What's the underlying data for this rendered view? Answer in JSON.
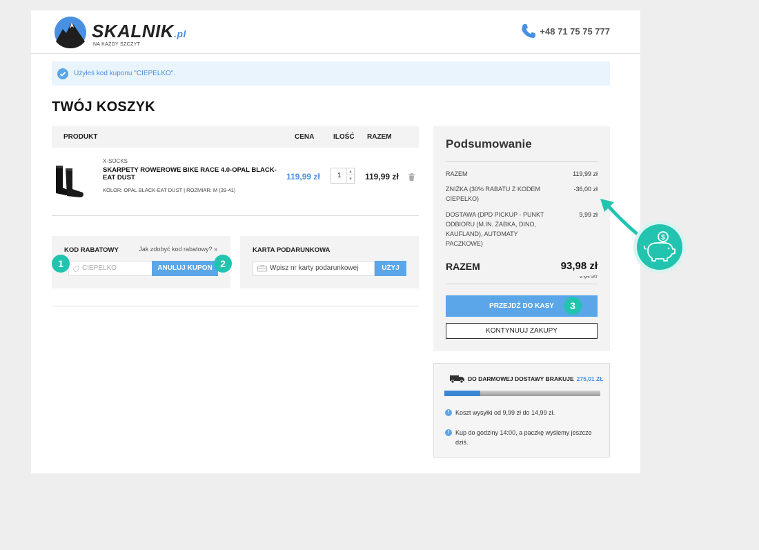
{
  "header": {
    "logo_name": "SKALNIK",
    "logo_suffix": ".pl",
    "logo_tagline": "NA KAŻDY SZCZYT",
    "phone": "+48 71 75 75 777"
  },
  "alert": {
    "text": "Użyłeś kod kuponu \"CIEPELKO\"."
  },
  "page_title": "TWÓJ KOSZYK",
  "cart": {
    "columns": {
      "product": "PRODUKT",
      "price": "CENA",
      "qty": "ILOŚĆ",
      "total": "RAZEM"
    },
    "items": [
      {
        "brand": "X-SOCKS",
        "name": "SKARPETY ROWEROWE BIKE RACE 4.0-OPAL BLACK-EAT DUST",
        "attributes": "KOLOR: OPAL BLACK-EAT DUST | ROZMIAR: M (39-41)",
        "price": "119,99 zł",
        "qty": "1",
        "total": "119,99 zł"
      }
    ]
  },
  "coupon": {
    "title": "KOD RABATOWY",
    "help_link": "Jak zdobyć kod rabatowy? »",
    "value": "CIEPELKO",
    "cancel_label": "ANULUJ KUPON"
  },
  "gift_card": {
    "title": "KARTA PODARUNKOWA",
    "placeholder": "Wpisz nr karty podarunkowej",
    "apply_label": "UŻYJ"
  },
  "summary": {
    "title": "Podsumowanie",
    "subtotal_label": "RAZEM",
    "subtotal_value": "119,99 zł",
    "discount_label": "ZNIŻKA (30% RABATU Z KODEM CIEPELKO)",
    "discount_value": "-36,00 zł",
    "shipping_label": "DOSTAWA (DPD PICKUP - PUNKT ODBIORU (M.IN. ŻABKA, DINO, KAUFLAND), AUTOMATY PACZKOWE)",
    "shipping_value": "9,99 zł",
    "total_label": "RAZEM",
    "total_value": "93,98 zł",
    "vat_note": "w tym VAT",
    "checkout_label": "PRZEJDŹ DO KASY",
    "continue_label": "KONTYNUUJ ZAKUPY"
  },
  "free_shipping": {
    "heading": "DO DARMOWEJ DOSTAWY BRAKUJE",
    "amount": "275,01 ZŁ",
    "progress": 0.23,
    "info": [
      "Koszt wysyłki od 9,99 zł do 14,99 zł.",
      "Kup do godziny 14:00, a paczkę wyślemy jeszcze dziś."
    ]
  },
  "steps": [
    "1",
    "2",
    "3"
  ],
  "colors": {
    "accent": "#5aa6e8",
    "teal": "#22c4b0",
    "link": "#4a90e2"
  }
}
